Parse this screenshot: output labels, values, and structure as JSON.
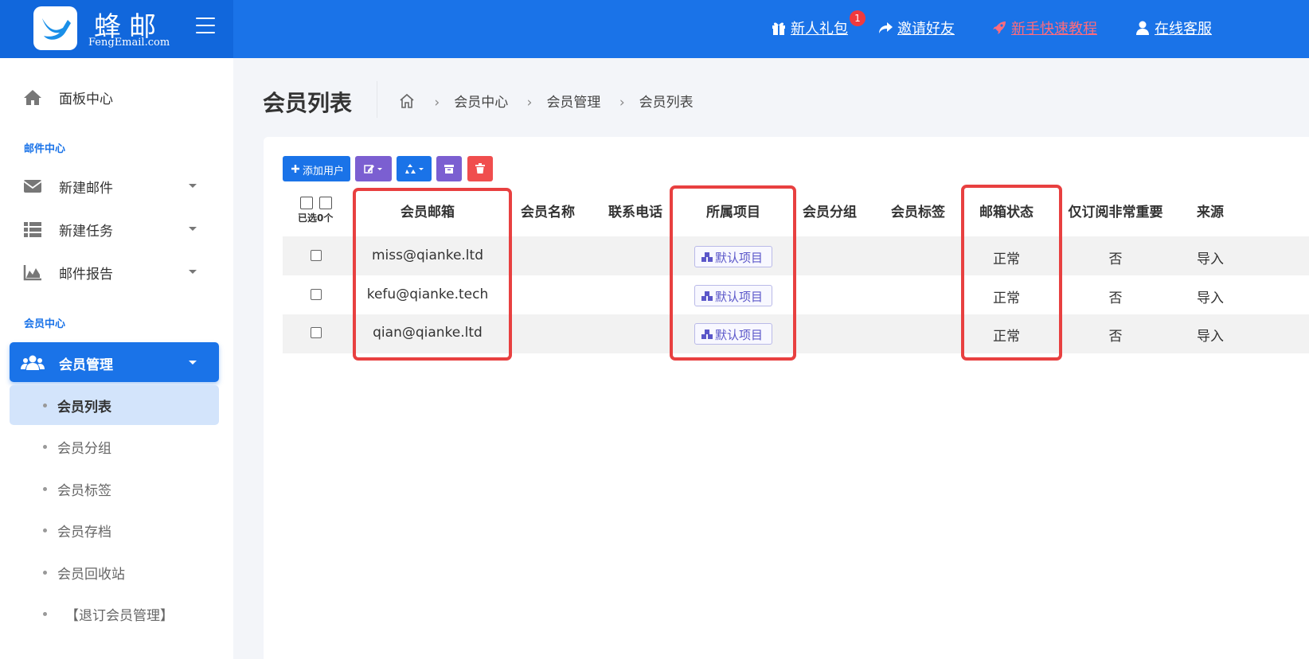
{
  "header": {
    "brand": "蜂邮",
    "brand_sub": "FengEmail.com",
    "nav": {
      "gift": "新人礼包",
      "gift_badge": "1",
      "invite": "邀请好友",
      "tutorial": "新手快速教程",
      "support": "在线客服"
    }
  },
  "sidebar": {
    "dashboard": "面板中心",
    "section_mail": "邮件中心",
    "new_mail": "新建邮件",
    "new_task": "新建任务",
    "mail_report": "邮件报告",
    "section_member": "会员中心",
    "member_manage": "会员管理",
    "subitems": [
      "会员列表",
      "会员分组",
      "会员标签",
      "会员存档",
      "会员回收站",
      "【退订会员管理】"
    ]
  },
  "page": {
    "title": "会员列表",
    "breadcrumb": [
      "会员中心",
      "会员管理",
      "会员列表"
    ]
  },
  "toolbar": {
    "add_user": "添加用户"
  },
  "table": {
    "selected_label": "已选0个",
    "columns": [
      "会员邮箱",
      "会员名称",
      "联系电话",
      "所属项目",
      "会员分组",
      "会员标签",
      "邮箱状态",
      "仅订阅非常重要",
      "来源"
    ],
    "rows": [
      {
        "email": "miss@qianke.ltd",
        "name": "",
        "phone": "",
        "project": "默认项目",
        "group": "",
        "tags": "",
        "status": "正常",
        "important_only": "否",
        "source": "导入"
      },
      {
        "email": "kefu@qianke.tech",
        "name": "",
        "phone": "",
        "project": "默认项目",
        "group": "",
        "tags": "",
        "status": "正常",
        "important_only": "否",
        "source": "导入"
      },
      {
        "email": "qian@qianke.ltd",
        "name": "",
        "phone": "",
        "project": "默认项目",
        "group": "",
        "tags": "",
        "status": "正常",
        "important_only": "否",
        "source": "导入"
      }
    ]
  },
  "colors": {
    "primary": "#1a73e8",
    "purple": "#7b5fd1",
    "danger": "#f04e4e",
    "highlight": "#e84040"
  }
}
